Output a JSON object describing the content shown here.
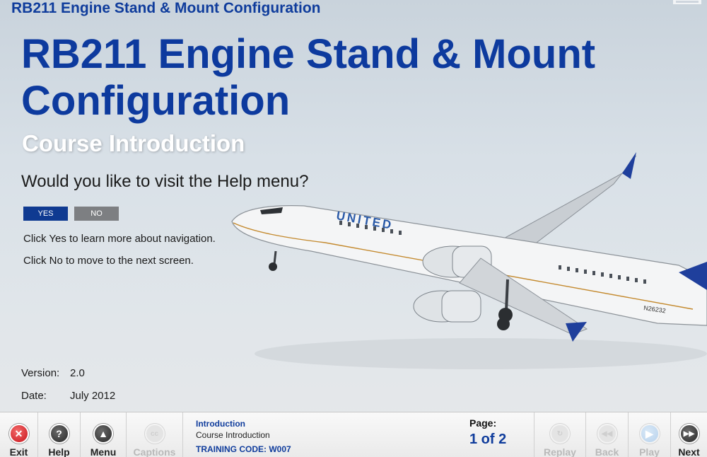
{
  "header": {
    "title": "RB211 Engine Stand & Mount Configuration"
  },
  "main": {
    "title": "RB211 Engine Stand & Mount Configuration",
    "subtitle": "Course Introduction",
    "question": "Would you like to visit the Help menu?",
    "yes_label": "YES",
    "no_label": "NO",
    "hint_yes": "Click Yes to learn more about navigation.",
    "hint_no": "Click No to move to the next screen.",
    "version_label": "Version:",
    "version_value": "2.0",
    "date_label": "Date:",
    "date_value": "July 2012",
    "aircraft_brand": "UNITED",
    "aircraft_reg": "N26232"
  },
  "toolbar": {
    "exit_label": "Exit",
    "help_label": "Help",
    "menu_label": "Menu",
    "captions_label": "Captions",
    "captions_icon_text": "cc",
    "section": "Introduction",
    "screen": "Course Introduction",
    "training_code": "TRAINING CODE: W007",
    "page_label": "Page:",
    "page_value": "1 of 2",
    "replay_label": "Replay",
    "back_label": "Back",
    "play_label": "Play",
    "next_label": "Next"
  },
  "colors": {
    "brand_blue": "#0f3c9c",
    "yes_button": "#0f3a91",
    "no_button": "#7d7f82",
    "exit_red": "#c8141c"
  },
  "icons": [
    "close-icon",
    "question-icon",
    "arrow-up-icon",
    "captions-icon",
    "replay-icon",
    "rewind-icon",
    "play-icon",
    "fast-forward-icon"
  ]
}
